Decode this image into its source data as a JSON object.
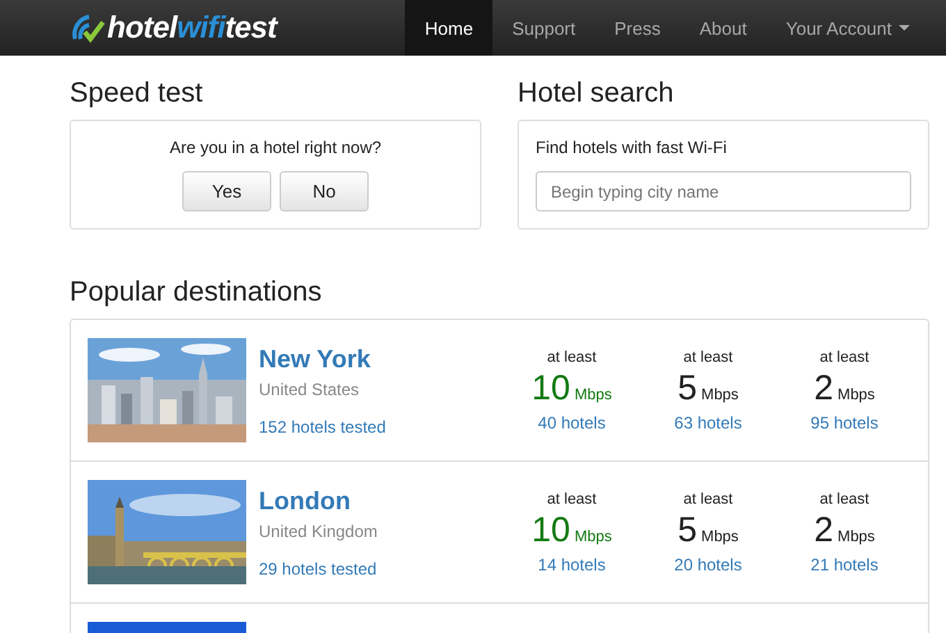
{
  "navbar": {
    "logo": {
      "part_1": "hotel",
      "part_2": "wifi",
      "part_3": "test"
    },
    "items": [
      {
        "label": "Home",
        "selected": true,
        "kind": "link"
      },
      {
        "label": "Support",
        "selected": false,
        "kind": "link"
      },
      {
        "label": "Press",
        "selected": false,
        "kind": "link"
      },
      {
        "label": "About",
        "selected": false,
        "kind": "link"
      },
      {
        "label": "Your Account",
        "selected": false,
        "kind": "dropdown"
      }
    ]
  },
  "speed_test": {
    "title": "Speed test",
    "question": "Are you in a hotel right now?",
    "buttons": [
      "Yes",
      "No"
    ]
  },
  "hotel_search": {
    "title": "Hotel search",
    "label": "Find hotels with fast Wi-Fi",
    "placeholder": "Begin typing city name"
  },
  "popular": {
    "title": "Popular destinations",
    "destinations": [
      {
        "city": "New York",
        "country": "United States",
        "tested": "152 hotels tested",
        "kind": "picture",
        "tiers": [
          {
            "caption": "at least",
            "speed": "10",
            "unit": "Mbps",
            "hotels": "40 hotels",
            "color": "#137a13"
          },
          {
            "caption": "at least",
            "speed": "5",
            "unit": "Mbps",
            "hotels": "63 hotels",
            "color": "#222222"
          },
          {
            "caption": "at least",
            "speed": "2",
            "unit": "Mbps",
            "hotels": "95 hotels",
            "color": "#222222"
          }
        ]
      },
      {
        "city": "London",
        "country": "United Kingdom",
        "tested": "29 hotels tested",
        "kind": "picture",
        "tiers": [
          {
            "caption": "at least",
            "speed": "10",
            "unit": "Mbps",
            "hotels": "14 hotels",
            "color": "#137a13"
          },
          {
            "caption": "at least",
            "speed": "5",
            "unit": "Mbps",
            "hotels": "20 hotels",
            "color": "#222222"
          },
          {
            "caption": "at least",
            "speed": "2",
            "unit": "Mbps",
            "hotels": "21 hotels",
            "color": "#222222"
          }
        ]
      },
      {
        "kind": "picture"
      }
    ]
  }
}
